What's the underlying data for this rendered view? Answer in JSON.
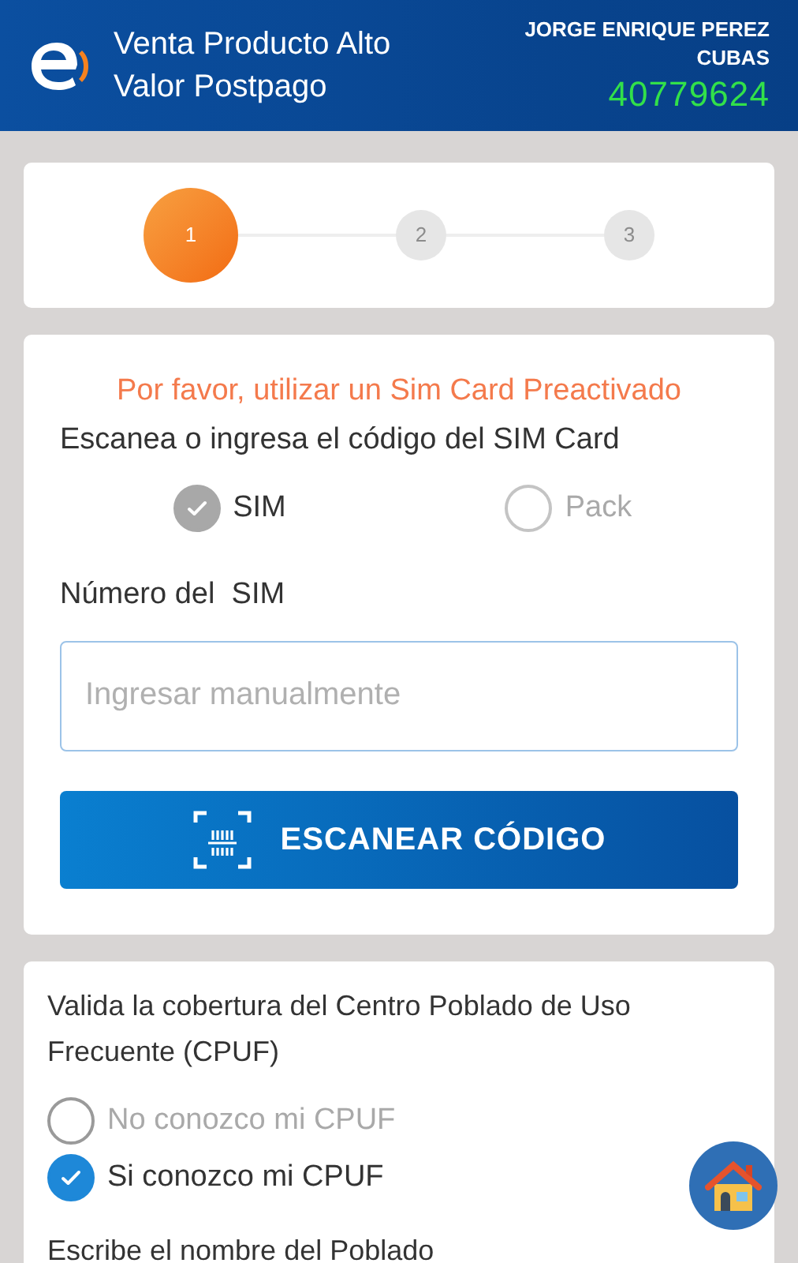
{
  "header": {
    "title": "Venta Producto Alto Valor Postpago",
    "user_name": "JORGE ENRIQUE PEREZ CUBAS",
    "user_code": "40779624"
  },
  "steps": [
    {
      "label": "1",
      "selected": true
    },
    {
      "label": "2",
      "selected": false
    },
    {
      "label": "3",
      "selected": false
    }
  ],
  "sim_card": {
    "notice": "Por favor, utilizar un Sim Card Preactivado",
    "instruction": "Escanea o ingresa el código del SIM Card",
    "options": [
      {
        "label": "SIM",
        "selected": true,
        "disabled": true
      },
      {
        "label": "Pack",
        "selected": false,
        "disabled": true
      }
    ],
    "field_label": "Número del  SIM",
    "field": {
      "placeholder": "Ingresar manualmente"
    },
    "scan_button": "ESCANEAR CÓDIGO"
  },
  "cpuf": {
    "question": "Valida la cobertura del Centro Poblado de Uso Frecuente (CPUF)",
    "options": [
      {
        "label": "No conozco mi CPUF",
        "selected": false,
        "disabled": false
      },
      {
        "label": "Si conozco mi CPUF",
        "selected": true,
        "disabled": false
      }
    ],
    "field_label": "Escribe el nombre del Poblado"
  }
}
